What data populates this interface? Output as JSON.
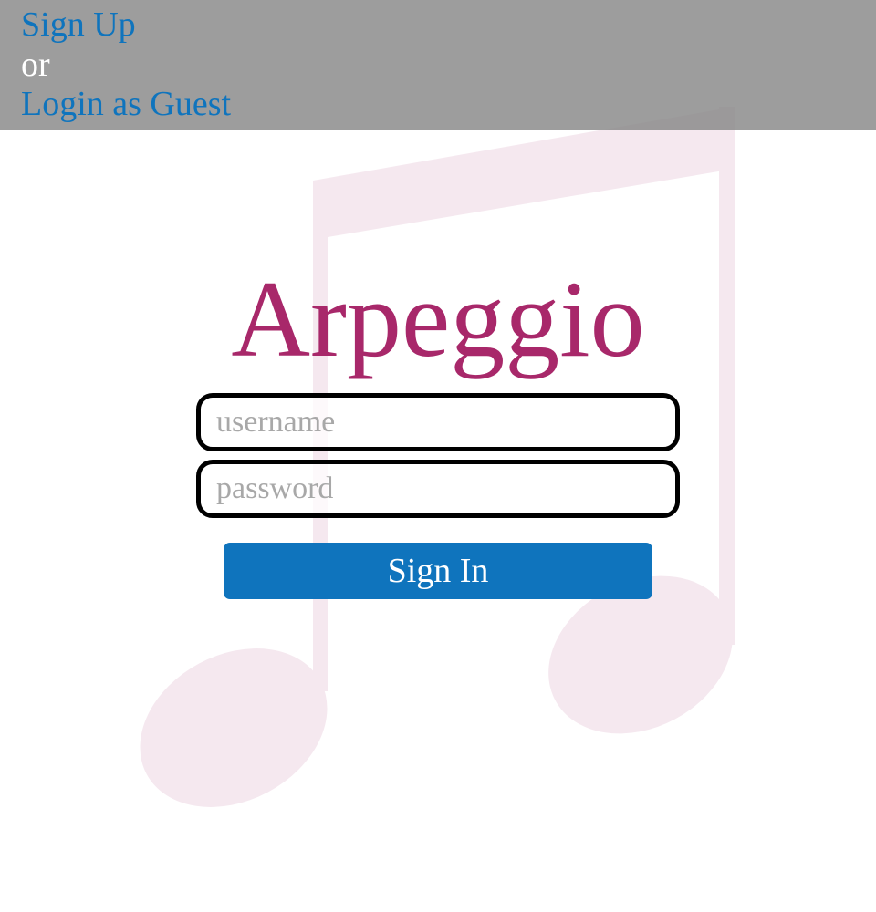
{
  "topbar": {
    "signup_label": "Sign Up",
    "or_text": "or",
    "guest_label": "Login as Guest"
  },
  "main": {
    "title": "Arpeggio",
    "username_placeholder": "username",
    "password_placeholder": "password",
    "signin_label": "Sign In"
  },
  "colors": {
    "accent": "#a8286a",
    "link": "#0f74bd",
    "button": "#0f74bd",
    "topbar": "#888888",
    "note": "#f5e6ee"
  },
  "icons": {
    "background": "music-note-icon"
  }
}
